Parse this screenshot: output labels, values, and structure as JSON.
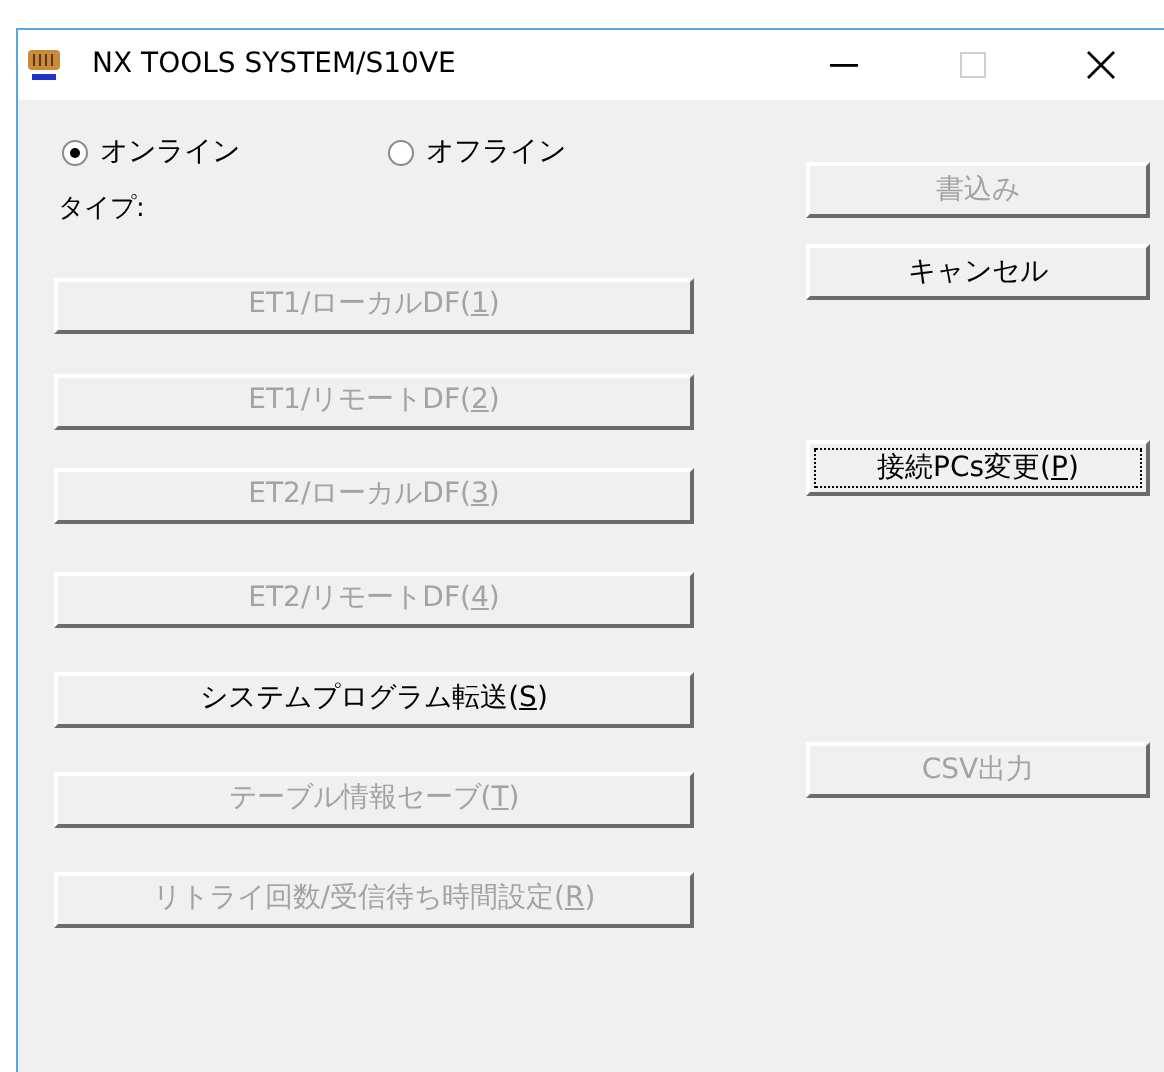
{
  "window": {
    "title": "NX TOOLS SYSTEM/S10VE"
  },
  "window_controls": [
    {
      "kind": "minimize",
      "disabled": false
    },
    {
      "kind": "maximize",
      "disabled": true
    },
    {
      "kind": "close",
      "disabled": false
    }
  ],
  "mode_radios": [
    {
      "label": "オンライン",
      "selected": true
    },
    {
      "label": "オフライン",
      "selected": false
    }
  ],
  "type_label": "タイプ:",
  "left_buttons": [
    {
      "label": "ET1/ローカルDF(",
      "access_key": "1",
      "label_end": ")",
      "disabled": true,
      "focused": false
    },
    {
      "label": "ET1/リモートDF(",
      "access_key": "2",
      "label_end": ")",
      "disabled": true,
      "focused": false
    },
    {
      "label": "ET2/ローカルDF(",
      "access_key": "3",
      "label_end": ")",
      "disabled": true,
      "focused": false
    },
    {
      "label": "ET2/リモートDF(",
      "access_key": "4",
      "label_end": ")",
      "disabled": true,
      "focused": false
    },
    {
      "label": "システムプログラム転送(",
      "access_key": "S",
      "label_end": ")",
      "disabled": false,
      "focused": false
    },
    {
      "label": "テーブル情報セーブ(",
      "access_key": "T",
      "label_end": ")",
      "disabled": true,
      "focused": false
    },
    {
      "label": "リトライ回数/受信待ち時間設定(",
      "access_key": "R",
      "label_end": ")",
      "disabled": true,
      "focused": false
    }
  ],
  "right_buttons": [
    {
      "label": "書込み",
      "disabled": true,
      "focused": false
    },
    {
      "label": "キャンセル",
      "disabled": false,
      "focused": false
    },
    {
      "label": "接続PCs変更(",
      "access_key": "P",
      "label_end": ")",
      "disabled": false,
      "focused": true
    },
    {
      "label": "CSV出力",
      "disabled": true,
      "focused": false
    }
  ]
}
